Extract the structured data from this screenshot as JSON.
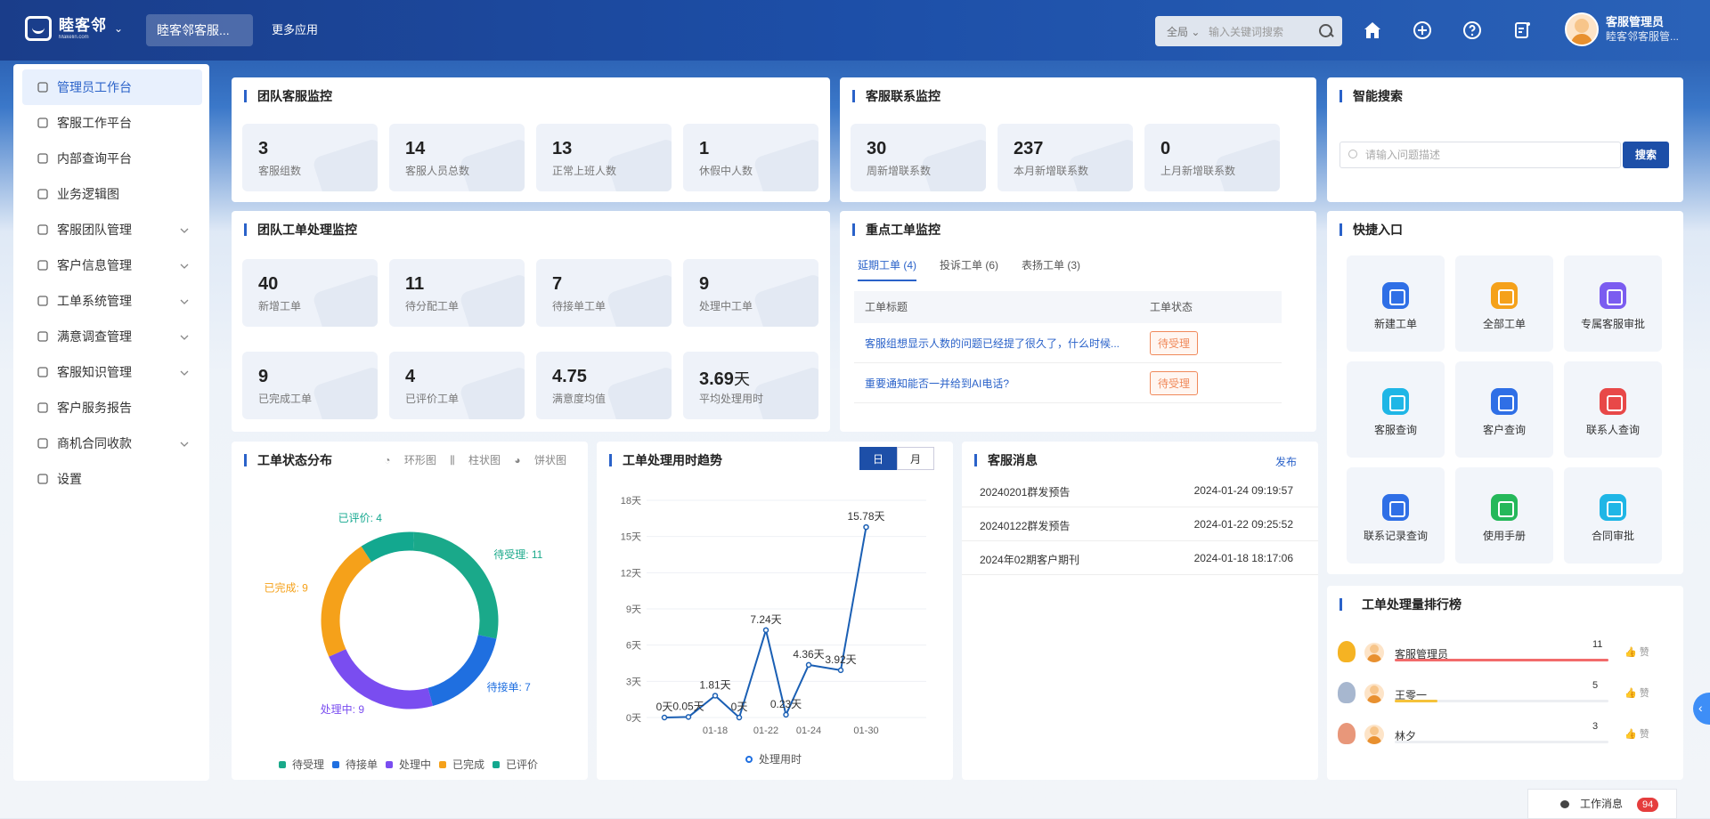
{
  "header": {
    "logo_name": "睦客邻",
    "logo_sub": "Makelin.com",
    "active_tab": "睦客邻客服...",
    "more_apps": "更多应用",
    "search_scope": "全局",
    "search_placeholder": "输入关键词搜索",
    "user_name": "客服管理员",
    "user_org": "睦客邻客服管..."
  },
  "sidebar": {
    "items": [
      {
        "label": "管理员工作台",
        "icon": "monitor-icon"
      },
      {
        "label": "客服工作平台",
        "icon": "headset-icon"
      },
      {
        "label": "内部查询平台",
        "icon": "cube-icon"
      },
      {
        "label": "业务逻辑图",
        "icon": "flow-icon"
      },
      {
        "label": "客服团队管理",
        "icon": "team-icon"
      },
      {
        "label": "客户信息管理",
        "icon": "user-icon"
      },
      {
        "label": "工单系统管理",
        "icon": "layers-icon"
      },
      {
        "label": "满意调查管理",
        "icon": "check-square-icon"
      },
      {
        "label": "客服知识管理",
        "icon": "smile-icon"
      },
      {
        "label": "客户服务报告",
        "icon": "report-icon"
      },
      {
        "label": "商机合同收款",
        "icon": "shop-icon"
      },
      {
        "label": "设置",
        "icon": "gear-icon"
      }
    ]
  },
  "team_monitor": {
    "title": "团队客服监控",
    "stats": [
      {
        "value": "3",
        "label": "客服组数"
      },
      {
        "value": "14",
        "label": "客服人员总数"
      },
      {
        "value": "13",
        "label": "正常上班人数"
      },
      {
        "value": "1",
        "label": "休假中人数"
      }
    ]
  },
  "contact_monitor": {
    "title": "客服联系监控",
    "stats": [
      {
        "value": "30",
        "label": "周新增联系数"
      },
      {
        "value": "237",
        "label": "本月新增联系数"
      },
      {
        "value": "0",
        "label": "上月新增联系数"
      }
    ]
  },
  "ticket_monitor": {
    "title": "团队工单处理监控",
    "stats": [
      {
        "value": "40",
        "label": "新增工单"
      },
      {
        "value": "11",
        "label": "待分配工单"
      },
      {
        "value": "7",
        "label": "待接单工单"
      },
      {
        "value": "9",
        "label": "处理中工单"
      },
      {
        "value": "9",
        "label": "已完成工单"
      },
      {
        "value": "4",
        "label": "已评价工单"
      },
      {
        "value": "4.75",
        "label": "满意度均值"
      },
      {
        "value": "3.69",
        "unit": "天",
        "label": "平均处理用时"
      }
    ]
  },
  "key_tickets": {
    "title": "重点工单监控",
    "tabs": [
      "延期工单 (4)",
      "投诉工单 (6)",
      "表扬工单 (3)"
    ],
    "col_title": "工单标题",
    "col_status": "工单状态",
    "rows": [
      {
        "title": "客服组想显示人数的问题已经提了很久了，什么时候...",
        "status": "待受理"
      },
      {
        "title": "重要通知能否一并给到AI电话?",
        "status": "待受理"
      }
    ]
  },
  "smart_search": {
    "title": "智能搜索",
    "placeholder": "请输入问题描述",
    "button": "搜索"
  },
  "quick_entry": {
    "title": "快捷入口",
    "items": [
      {
        "label": "新建工单",
        "color": "#2f6fe6"
      },
      {
        "label": "全部工单",
        "color": "#f5a11a"
      },
      {
        "label": "专属客服审批",
        "color": "#7b5cf0"
      },
      {
        "label": "客服查询",
        "color": "#1fb6e6"
      },
      {
        "label": "客户查询",
        "color": "#2f6fe6"
      },
      {
        "label": "联系人查询",
        "color": "#e84848"
      },
      {
        "label": "联系记录查询",
        "color": "#2f6fe6"
      },
      {
        "label": "使用手册",
        "color": "#25b85a"
      },
      {
        "label": "合同审批",
        "color": "#1fb6e6"
      }
    ]
  },
  "status_dist": {
    "title": "工单状态分布",
    "types": [
      "环形图",
      "柱状图",
      "饼状图"
    ]
  },
  "trend": {
    "title": "工单处理用时趋势",
    "modes": [
      "日",
      "月"
    ]
  },
  "chart_data": [
    {
      "type": "pie",
      "title": "工单状态分布",
      "categories": [
        "待受理",
        "待接单",
        "处理中",
        "已完成",
        "已评价"
      ],
      "values": [
        11,
        7,
        9,
        9,
        4
      ],
      "colors": [
        "#1aa98a",
        "#1f6fe0",
        "#7a4df0",
        "#f5a11a",
        "#13a88f"
      ],
      "legend": "bottom",
      "style": "donut"
    },
    {
      "type": "line",
      "title": "工单处理用时趋势",
      "series": [
        {
          "name": "处理用时",
          "values": [
            0,
            0.05,
            1.81,
            0,
            7.24,
            0.23,
            4.36,
            3.92,
            15.78
          ]
        }
      ],
      "x": [
        "01-14",
        "01-16",
        "01-18",
        "01-20",
        "01-22",
        "01-23",
        "01-24",
        "01-26",
        "01-30"
      ],
      "value_labels": [
        "0天",
        "0.05天",
        "1.81天",
        "0天",
        "7.24天",
        "0.23天",
        "4.36天",
        "3.92天",
        "15.78天"
      ],
      "xticks": [
        "01-18",
        "01-22",
        "01-24",
        "01-30"
      ],
      "yticks": [
        "0天",
        "3天",
        "6天",
        "9天",
        "12天",
        "15天",
        "18天"
      ],
      "ylim": [
        0,
        18
      ],
      "grid": true,
      "legend": "bottom"
    }
  ],
  "messages": {
    "title": "客服消息",
    "action": "发布",
    "rows": [
      {
        "title": "20240201群发预告",
        "date": "2024-01-24 09:19:57"
      },
      {
        "title": "20240122群发预告",
        "date": "2024-01-22 09:25:52"
      },
      {
        "title": "2024年02期客户期刊",
        "date": "2024-01-18 18:17:06"
      }
    ]
  },
  "ranking": {
    "title": "工单处理量排行榜",
    "like": "赞",
    "rows": [
      {
        "name": "客服管理员",
        "count": 11,
        "share": 1.0,
        "bar_color": "#f26b6b",
        "medal": "#f5b323"
      },
      {
        "name": "王零一",
        "count": 5,
        "share": 0.2,
        "bar_color": "#f5c23a",
        "medal": "#a7b7cf"
      },
      {
        "name": "林夕",
        "count": 3,
        "share": 0.0,
        "bar_color": "#e0e0e0",
        "medal": "#e8977a"
      }
    ]
  },
  "work_msg": {
    "label": "工作消息",
    "count": "94"
  }
}
